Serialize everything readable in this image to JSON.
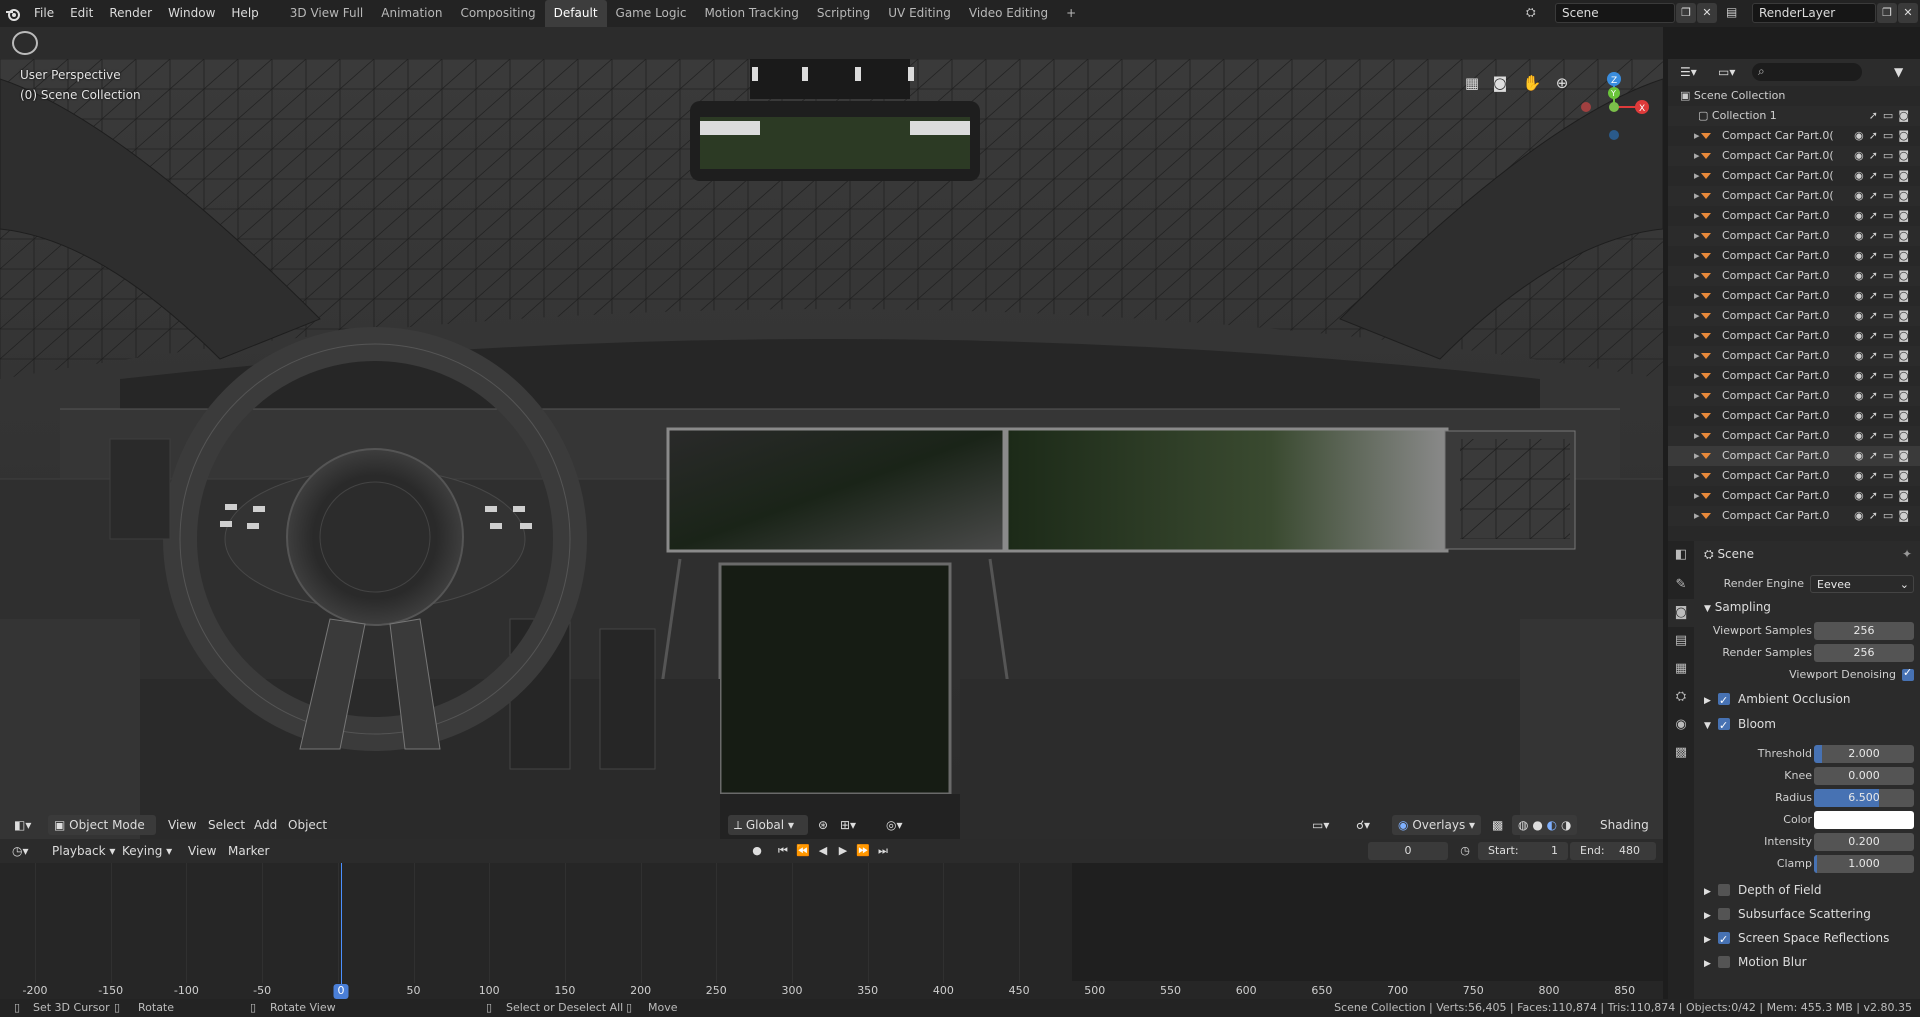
{
  "menu": [
    "File",
    "Edit",
    "Render",
    "Window",
    "Help"
  ],
  "workspaces": [
    "3D View Full",
    "Animation",
    "Compositing",
    "Default",
    "Game Logic",
    "Motion Tracking",
    "Scripting",
    "UV Editing",
    "Video Editing"
  ],
  "active_workspace": "Default",
  "add_workspace": "+",
  "scene_name": "Scene",
  "view_layer": "RenderLayer",
  "viewport": {
    "perspective": "User Perspective",
    "collection": "(0) Scene Collection",
    "mode": "Object Mode",
    "menus": [
      "View",
      "Select",
      "Add",
      "Object"
    ],
    "transform_orientation": "Global",
    "overlays": "Overlays",
    "shading": "Shading",
    "gizmo_axes": [
      "X",
      "Y",
      "Z"
    ]
  },
  "timeline": {
    "menus": [
      "Playback",
      "Keying",
      "View",
      "Marker"
    ],
    "current_frame": "0",
    "start_label": "Start:",
    "start": "1",
    "end_label": "End:",
    "end": "480",
    "ruler": [
      "-200",
      "-150",
      "-100",
      "-50",
      "0",
      "50",
      "100",
      "150",
      "200",
      "250",
      "300",
      "350",
      "400",
      "450",
      "500",
      "550",
      "600",
      "650",
      "700",
      "750",
      "800",
      "850"
    ],
    "current_frame_badge": "0"
  },
  "statusbar": {
    "set_cursor": "Set 3D Cursor",
    "rotate": "Rotate",
    "rotate_view": "Rotate View",
    "select": "Select or Deselect All",
    "move": "Move",
    "stats": "Scene Collection | Verts:56,405 | Faces:110,874 | Tris:110,874 | Objects:0/42 | Mem: 455.3 MB | v2.80.35"
  },
  "outliner": {
    "root": "Scene Collection",
    "collection": "Collection 1",
    "items": [
      "Compact Car Part.0(",
      "Compact Car Part.0(",
      "Compact Car Part.0(",
      "Compact Car Part.0(",
      "Compact Car Part.0",
      "Compact Car Part.0",
      "Compact Car Part.0",
      "Compact Car Part.0",
      "Compact Car Part.0",
      "Compact Car Part.0",
      "Compact Car Part.0",
      "Compact Car Part.0",
      "Compact Car Part.0",
      "Compact Car Part.0",
      "Compact Car Part.0",
      "Compact Car Part.0",
      "Compact Car Part.0",
      "Compact Car Part.0",
      "Compact Car Part.0",
      "Compact Car Part.0"
    ]
  },
  "properties": {
    "context": "Scene",
    "render_engine_label": "Render Engine",
    "render_engine": "Eevee",
    "sampling": "Sampling",
    "viewport_samples_label": "Viewport Samples",
    "viewport_samples": "256",
    "render_samples_label": "Render Samples",
    "render_samples": "256",
    "viewport_denoising": "Viewport Denoising",
    "ambient_occlusion": "Ambient Occlusion",
    "bloom": "Bloom",
    "threshold_label": "Threshold",
    "threshold": "2.000",
    "threshold_fill": 0.08,
    "knee_label": "Knee",
    "knee": "0.000",
    "knee_fill": 0.0,
    "radius_label": "Radius",
    "radius": "6.500",
    "radius_fill": 0.65,
    "color_label": "Color",
    "color_value": "#ffffff",
    "intensity_label": "Intensity",
    "intensity": "0.200",
    "intensity_fill": 0.0,
    "clamp_label": "Clamp",
    "clamp": "1.000",
    "clamp_fill": 0.03,
    "depth_of_field": "Depth of Field",
    "subsurface": "Subsurface Scattering",
    "ssr": "Screen Space Reflections",
    "motion_blur": "Motion Blur"
  },
  "colors": {
    "accent": "#4772b3",
    "object_icon": "#e8893a"
  }
}
